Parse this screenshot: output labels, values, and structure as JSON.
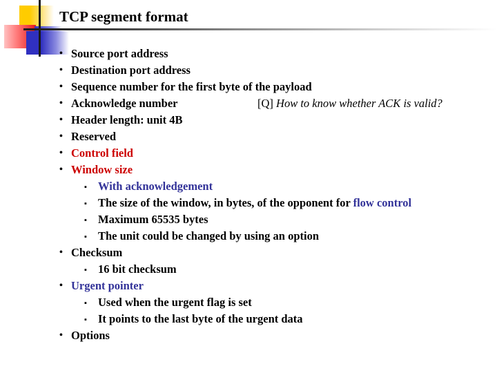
{
  "title": "TCP segment format",
  "colors": {
    "red": "#cc0000",
    "blue": "#333399",
    "text": "#000000"
  },
  "icons": {
    "bullet": "•",
    "sub_bullet": "▪",
    "logo": "decorative-squares-logo"
  },
  "items": [
    {
      "text": "Source port address"
    },
    {
      "text": "Destination port address"
    },
    {
      "text": "Sequence number for the first byte of the payload"
    },
    {
      "text": "Acknowledge number",
      "note_prefix": "[Q]",
      "note": "How to know whether ACK is valid?"
    },
    {
      "text": "Header length: unit 4B"
    },
    {
      "text": "Reserved"
    },
    {
      "text": "Control field",
      "color": "red"
    },
    {
      "text": "Window size",
      "color": "red",
      "sub": [
        {
          "text": "With acknowledgement",
          "color": "blue"
        },
        {
          "text": "The size of the window, in bytes, of the opponent for ",
          "highlight": "flow control"
        },
        {
          "text": "Maximum 65535 bytes"
        },
        {
          "text": "The unit could be changed by using an option"
        }
      ]
    },
    {
      "text": "Checksum",
      "sub": [
        {
          "text": "16 bit checksum"
        }
      ]
    },
    {
      "text": "Urgent pointer",
      "color": "blue",
      "sub": [
        {
          "text": "Used when the urgent flag is set"
        },
        {
          "text": "It points to the last byte of the urgent data"
        }
      ]
    },
    {
      "text": "Options"
    }
  ]
}
